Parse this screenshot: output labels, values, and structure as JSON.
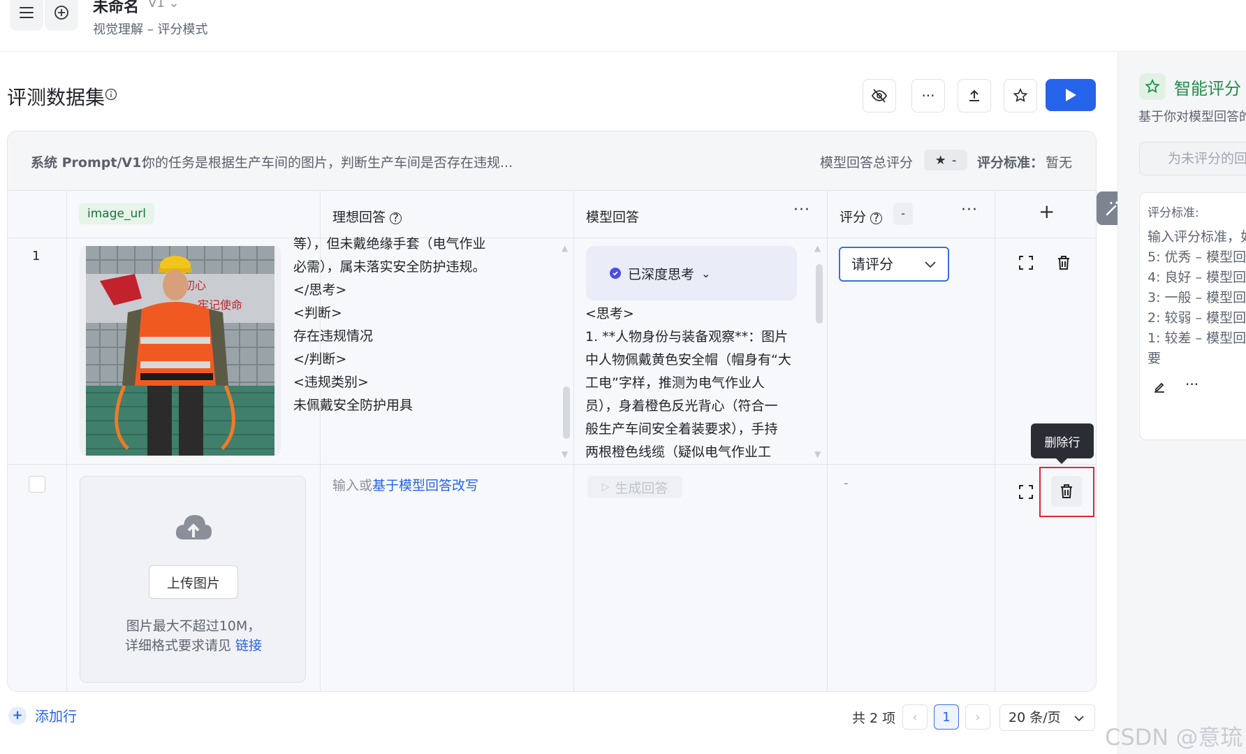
{
  "header": {
    "title": "未命名",
    "version": "V1",
    "subtitle": "视觉理解 – 评分模式"
  },
  "section": {
    "title": "评测数据集"
  },
  "prompt_bar": {
    "label": "系统 Prompt/V1：",
    "text": "你的任务是根据生产车间的图片，判断生产车间是否存在违规...",
    "score_total_label": "模型回答总评分",
    "score_total_value": "-",
    "standard_label": "评分标准：",
    "standard_value": "暂无"
  },
  "table": {
    "headers": {
      "image": "image_url",
      "ideal": "理想回答",
      "model": "模型回答",
      "score": "评分",
      "score_badge": "-"
    },
    "row1": {
      "index": "1",
      "ideal_lines": [
        "等），但未戴绝缘手套（电气作业",
        "必需），属未落实安全防护违规。",
        "</思考>",
        "<判断>",
        "存在违规情况",
        "</判断>",
        "<违规类别>",
        "未佩戴安全防护用具"
      ],
      "thinking_label": "已深度思考",
      "model_lines": [
        "<思考>",
        "1. **人物身份与装备观察**：图片",
        "中人物佩戴黄色安全帽（帽身有“大",
        "工电”字样，推测为电气作业人",
        "员），身着橙色反光背心（符合一",
        "般生产车间安全着装要求），手持",
        "两根橙色线缆（疑似电气作业工"
      ],
      "score_placeholder": "请评分",
      "image_text_1": "初心",
      "image_text_2": "牢记使命"
    },
    "row2": {
      "ideal_prefix": "输入或",
      "ideal_link": "基于模型回答改写",
      "generate_label": "生成回答",
      "score_value": "-",
      "upload_label": "上传图片",
      "upload_hint_1": "图片最大不超过10M，",
      "upload_hint_2": "详细格式要求请见 ",
      "upload_link": "链接",
      "delete_tooltip": "删除行"
    }
  },
  "footer": {
    "add_row": "添加行",
    "total": "共 2 项",
    "current_page": "1",
    "page_size": "20 条/页"
  },
  "right_panel": {
    "title": "智能评分",
    "subtitle": "基于你对模型回答的",
    "button": "为未评分的回",
    "card_title": "评分标准:",
    "lines": [
      "输入评分标准，如",
      "5: 优秀 – 模型回",
      "4: 良好 – 模型回",
      "3: 一般 – 模型回",
      "2: 较弱 – 模型回",
      "1: 较差 – 模型回",
      "要"
    ]
  },
  "watermark": "CSDN @意琉",
  "colors": {
    "accent": "#2563eb",
    "green": "#1f8f4a",
    "danger": "#e0262e"
  }
}
